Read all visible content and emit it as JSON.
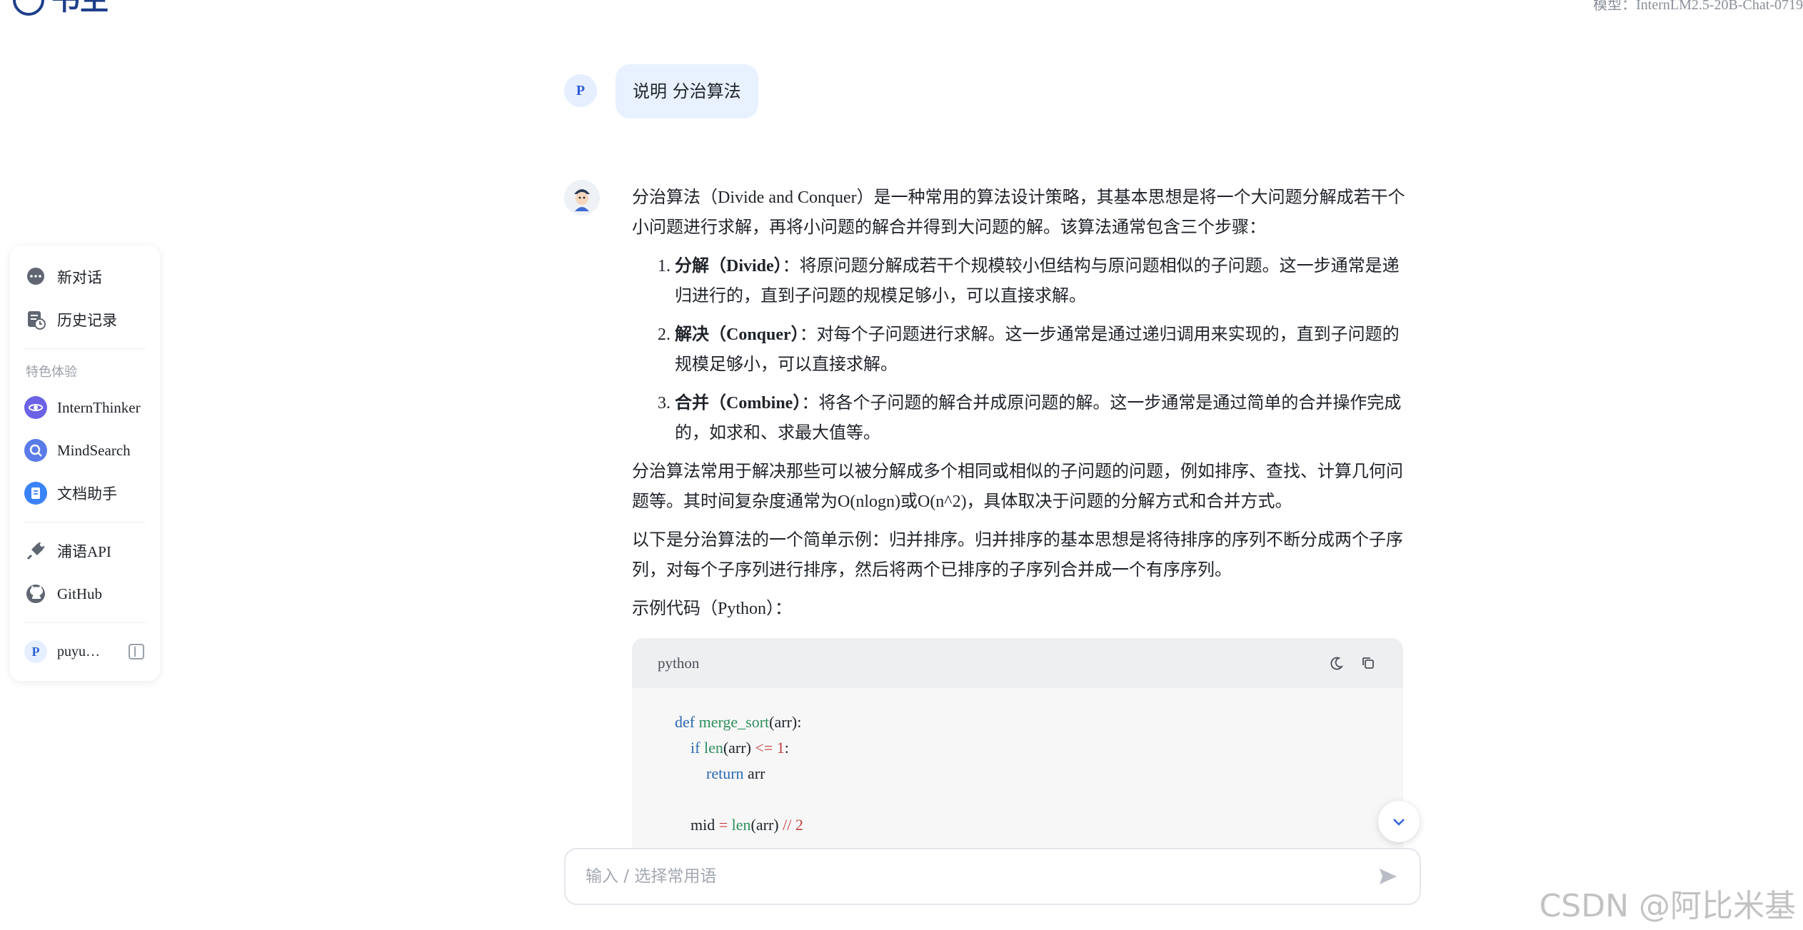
{
  "header": {
    "logo_text": "书生",
    "model_label": "模型：InternLM2.5-20B-Chat-0719"
  },
  "sidebar": {
    "new_chat": "新对话",
    "history": "历史记录",
    "section_label": "特色体验",
    "features": [
      {
        "label": "InternThinker",
        "color": "#6b62e6"
      },
      {
        "label": "MindSearch",
        "color": "#5a7be8"
      },
      {
        "label": "文档助手",
        "color": "#3b82f6"
      }
    ],
    "api": "浦语API",
    "github": "GitHub",
    "user_initial": "P",
    "user_name": "puyu…"
  },
  "chat": {
    "user_initial": "P",
    "user_message": "说明 分治算法",
    "reply": {
      "intro": "分治算法（Divide and Conquer）是一种常用的算法设计策略，其基本思想是将一个大问题分解成若干个小问题进行求解，再将小问题的解合并得到大问题的解。该算法通常包含三个步骤：",
      "steps": [
        {
          "title": "分解（Divide）",
          "text": "：将原问题分解成若干个规模较小但结构与原问题相似的子问题。这一步通常是递归进行的，直到子问题的规模足够小，可以直接求解。"
        },
        {
          "title": "解决（Conquer）",
          "text": "：对每个子问题进行求解。这一步通常是通过递归调用来实现的，直到子问题的规模足够小，可以直接求解。"
        },
        {
          "title": "合并（Combine）",
          "text": "：将各个子问题的解合并成原问题的解。这一步通常是通过简单的合并操作完成的，如求和、求最大值等。"
        }
      ],
      "para2": "分治算法常用于解决那些可以被分解成多个相同或相似的子问题的问题，例如排序、查找、计算几何问题等。其时间复杂度通常为O(nlogn)或O(n^2)，具体取决于问题的分解方式和合并方式。",
      "para3": "以下是分治算法的一个简单示例：归并排序。归并排序的基本思想是将待排序的序列不断分成两个子序列，对每个子序列进行排序，然后将两个已排序的子序列合并成一个有序序列。",
      "code_intro": "示例代码（Python）：",
      "code_lang": "python"
    }
  },
  "input": {
    "placeholder": "输入 / 选择常用语"
  },
  "watermark": "CSDN @阿比米基"
}
